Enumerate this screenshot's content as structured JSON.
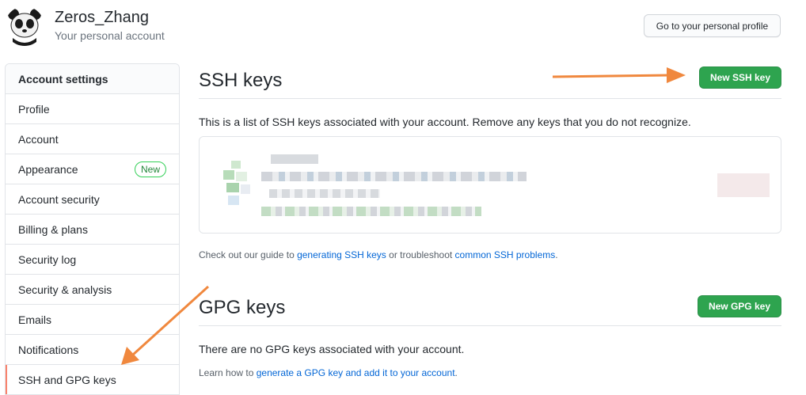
{
  "user": {
    "name": "Zeros_Zhang",
    "subtitle": "Your personal account"
  },
  "header": {
    "profile_button": "Go to your personal profile"
  },
  "sidebar": {
    "heading": "Account settings",
    "items": [
      {
        "label": "Profile"
      },
      {
        "label": "Account"
      },
      {
        "label": "Appearance",
        "badge": "New"
      },
      {
        "label": "Account security"
      },
      {
        "label": "Billing & plans"
      },
      {
        "label": "Security log"
      },
      {
        "label": "Security & analysis"
      },
      {
        "label": "Emails"
      },
      {
        "label": "Notifications"
      },
      {
        "label": "SSH and GPG keys",
        "active": true
      }
    ]
  },
  "ssh": {
    "title": "SSH keys",
    "new_button": "New SSH key",
    "description": "This is a list of SSH keys associated with your account. Remove any keys that you do not recognize.",
    "help_prefix": "Check out our guide to ",
    "help_link1": "generating SSH keys",
    "help_middle": " or troubleshoot ",
    "help_link2": "common SSH problems",
    "help_suffix": "."
  },
  "gpg": {
    "title": "GPG keys",
    "new_button": "New GPG key",
    "description": "There are no GPG keys associated with your account.",
    "help_prefix": "Learn how to ",
    "help_link": "generate a GPG key and add it to your account",
    "help_suffix": "."
  },
  "colors": {
    "accent_green": "#2ea44f",
    "link_blue": "#0366d6",
    "active_marker": "#f9826c",
    "annotation_arrow": "#f0883e"
  }
}
